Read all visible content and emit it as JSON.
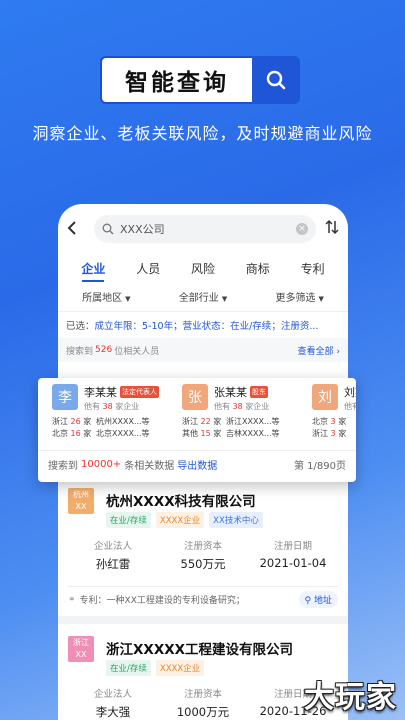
{
  "hero": {
    "search_text": "智能查询",
    "tagline": "洞察企业、老板关联风险，及时规避商业风险"
  },
  "app": {
    "search_placeholder": "XXX公司",
    "tabs": [
      {
        "label": "企业",
        "active": true
      },
      {
        "label": "人员"
      },
      {
        "label": "风险"
      },
      {
        "label": "商标"
      },
      {
        "label": "专利"
      }
    ],
    "filters": [
      "所属地区",
      "全部行业",
      "更多筛选"
    ],
    "chosen": {
      "prefix": "已选：",
      "f1_label": "成立年限：",
      "f1_value": "5-10年",
      "f2_label": "；营业状态：",
      "f2_value": "在业/存续",
      "f3_label": "；注册资..."
    },
    "people_header": {
      "prefix": "搜索到",
      "count": "526",
      "suffix": "位相关人员",
      "see_all": "查看全部 ›"
    },
    "people": [
      {
        "avatar": "李",
        "avatar_color": "#7aa9ea",
        "name": "李某某",
        "tag": "法定代表人",
        "sub_prefix": "他有",
        "sub_count": "38",
        "sub_suffix": "家企业",
        "r1c1a": "浙江",
        "r1c1b": "26",
        "r1c1c": "家",
        "r1c2": "杭州XXXX...等",
        "r2c1a": "北京",
        "r2c1b": "16",
        "r2c1c": "家",
        "r2c2": "北京XXXX...等"
      },
      {
        "avatar": "张",
        "avatar_color": "#f0a77c",
        "name": "张某某",
        "tag": "股东",
        "sub_prefix": "他有",
        "sub_count": "38",
        "sub_suffix": "家企业",
        "r1c1a": "浙江",
        "r1c1b": "22",
        "r1c1c": "家",
        "r1c2": "浙江XXXX...等",
        "r2c1a": "其他",
        "r2c1b": "15",
        "r2c1c": "家",
        "r2c2": "吉林XXXX...等"
      },
      {
        "avatar": "刘",
        "avatar_color": "#f0a77c",
        "name": "刘某",
        "tag": "",
        "sub_prefix": "他有",
        "sub_count": "",
        "sub_suffix": "",
        "r1c1a": "北京",
        "r1c1b": "3",
        "r1c1c": "家",
        "r1c2": "",
        "r2c1a": "浙江",
        "r2c1b": "3",
        "r2c1c": "家",
        "r2c2": ""
      }
    ],
    "data_footer": {
      "prefix": "搜索到",
      "count": "10000+",
      "suffix": "条相关数据",
      "export": "导出数据",
      "page": "第 1/890页"
    },
    "companies": [
      {
        "logo": "杭州\nXX",
        "logo_line1": "杭州",
        "logo_line2": "XX",
        "logo_color": "#f2ad6b",
        "name": "杭州XXXX科技有限公司",
        "tags": [
          "在业/存续",
          "XXXX企业",
          "XX技术中心"
        ],
        "stat_labels": [
          "企业法人",
          "注册资本",
          "注册日期"
        ],
        "stat_values": [
          "孙红雷",
          "550万元",
          "2021-01-04"
        ],
        "patent": "专利：一种XX工程建设的专利设备研究；",
        "address": "地址"
      },
      {
        "logo_line1": "浙江",
        "logo_line2": "XX",
        "logo_color": "#ef8fb5",
        "name": "浙江XXXXX工程建设有限公司",
        "tags": [
          "在业/存续",
          "XXXX企业"
        ],
        "stat_labels": [
          "企业法人",
          "注册资本",
          "注册日期"
        ],
        "stat_values": [
          "李大强",
          "1000万元",
          "2020-11-26"
        ]
      }
    ]
  },
  "watermark": "大玩家",
  "colors": {
    "brand": "#1f56d8",
    "highlight": "#ee3333"
  }
}
